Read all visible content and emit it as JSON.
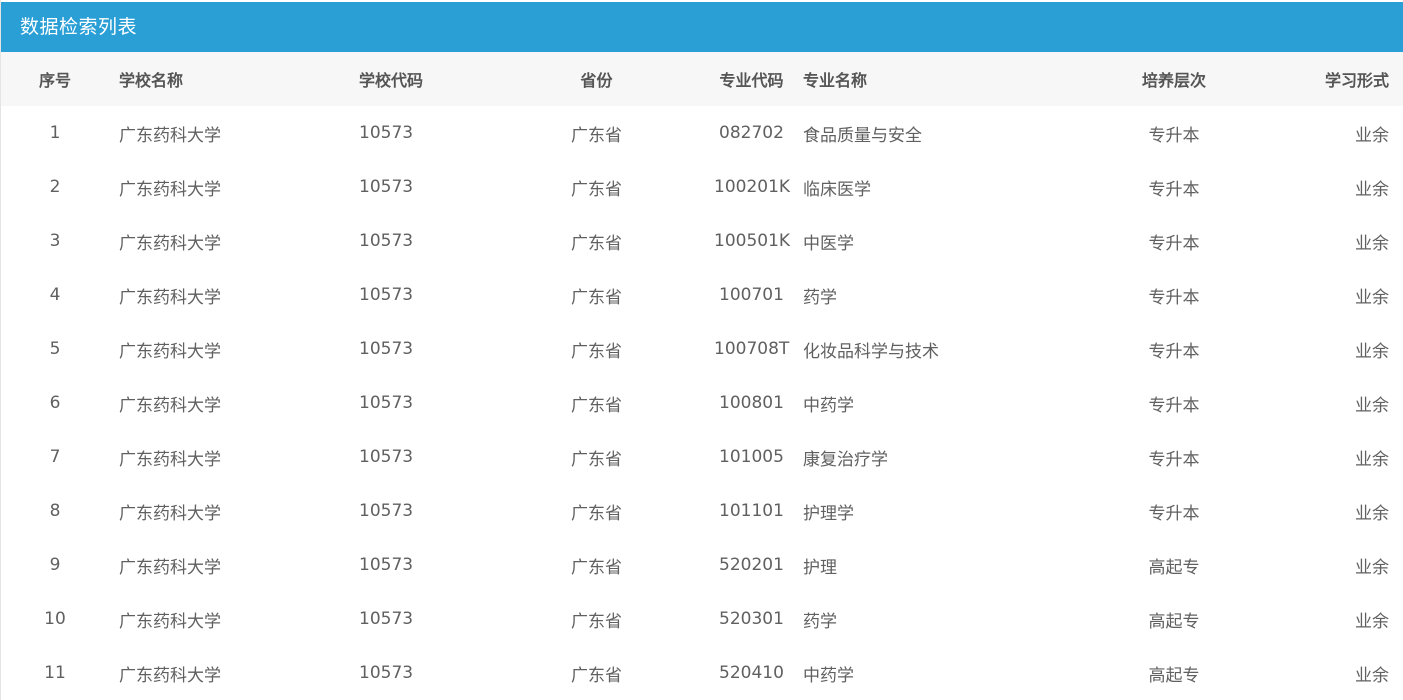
{
  "header": {
    "title": "数据检索列表"
  },
  "columns": {
    "seq": "序号",
    "school_name": "学校名称",
    "school_code": "学校代码",
    "province": "省份",
    "major_code": "专业代码",
    "major_name": "专业名称",
    "level": "培养层次",
    "study_form": "学习形式"
  },
  "rows": [
    {
      "seq": "1",
      "school_name": "广东药科大学",
      "school_code": "10573",
      "province": "广东省",
      "major_code": "082702",
      "major_name": "食品质量与安全",
      "level": "专升本",
      "study_form": "业余"
    },
    {
      "seq": "2",
      "school_name": "广东药科大学",
      "school_code": "10573",
      "province": "广东省",
      "major_code": "100201K",
      "major_name": "临床医学",
      "level": "专升本",
      "study_form": "业余"
    },
    {
      "seq": "3",
      "school_name": "广东药科大学",
      "school_code": "10573",
      "province": "广东省",
      "major_code": "100501K",
      "major_name": "中医学",
      "level": "专升本",
      "study_form": "业余"
    },
    {
      "seq": "4",
      "school_name": "广东药科大学",
      "school_code": "10573",
      "province": "广东省",
      "major_code": "100701",
      "major_name": "药学",
      "level": "专升本",
      "study_form": "业余"
    },
    {
      "seq": "5",
      "school_name": "广东药科大学",
      "school_code": "10573",
      "province": "广东省",
      "major_code": "100708T",
      "major_name": "化妆品科学与技术",
      "level": "专升本",
      "study_form": "业余"
    },
    {
      "seq": "6",
      "school_name": "广东药科大学",
      "school_code": "10573",
      "province": "广东省",
      "major_code": "100801",
      "major_name": "中药学",
      "level": "专升本",
      "study_form": "业余"
    },
    {
      "seq": "7",
      "school_name": "广东药科大学",
      "school_code": "10573",
      "province": "广东省",
      "major_code": "101005",
      "major_name": "康复治疗学",
      "level": "专升本",
      "study_form": "业余"
    },
    {
      "seq": "8",
      "school_name": "广东药科大学",
      "school_code": "10573",
      "province": "广东省",
      "major_code": "101101",
      "major_name": "护理学",
      "level": "专升本",
      "study_form": "业余"
    },
    {
      "seq": "9",
      "school_name": "广东药科大学",
      "school_code": "10573",
      "province": "广东省",
      "major_code": "520201",
      "major_name": "护理",
      "level": "高起专",
      "study_form": "业余"
    },
    {
      "seq": "10",
      "school_name": "广东药科大学",
      "school_code": "10573",
      "province": "广东省",
      "major_code": "520301",
      "major_name": "药学",
      "level": "高起专",
      "study_form": "业余"
    },
    {
      "seq": "11",
      "school_name": "广东药科大学",
      "school_code": "10573",
      "province": "广东省",
      "major_code": "520410",
      "major_name": "中药学",
      "level": "高起专",
      "study_form": "业余"
    }
  ],
  "colors": {
    "header_bg": "#2a9fd6",
    "table_head_bg": "#f7f7f7",
    "text": "#606060"
  }
}
